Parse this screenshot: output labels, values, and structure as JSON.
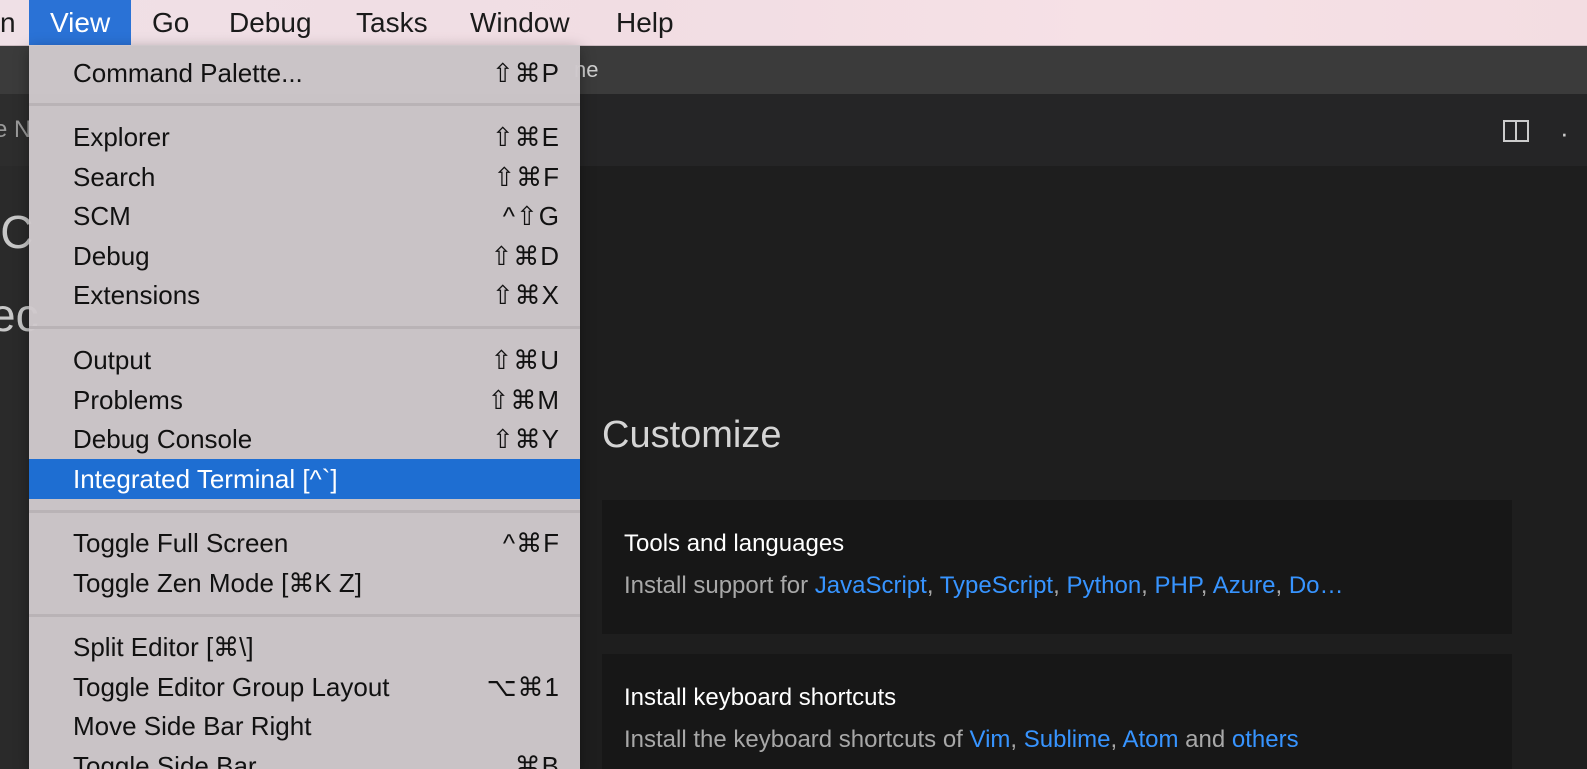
{
  "menubar": {
    "items": [
      {
        "label": "n"
      },
      {
        "label": "View"
      },
      {
        "label": "Go"
      },
      {
        "label": "Debug"
      },
      {
        "label": "Tasks"
      },
      {
        "label": "Window"
      },
      {
        "label": "Help"
      }
    ]
  },
  "editor": {
    "title_fragment": "ne",
    "tab_fragment": "e N",
    "welcome_fragment_1": "lC",
    "welcome_fragment_2": "ec",
    "customize": {
      "heading": "Customize",
      "cards": [
        {
          "title": "Tools and languages",
          "prefix": "Install support for ",
          "links": [
            "JavaScript",
            "TypeScript",
            "Python",
            "PHP",
            "Azure",
            "Do…"
          ]
        },
        {
          "title": "Install keyboard shortcuts",
          "prefix": "Install the keyboard shortcuts of ",
          "links": [
            "Vim",
            "Sublime",
            "Atom"
          ],
          "conjunction": " and ",
          "last_link": "others"
        }
      ]
    }
  },
  "view_menu": {
    "groups": [
      [
        {
          "label": "Command Palette...",
          "shortcut": "⇧⌘P"
        }
      ],
      [
        {
          "label": "Explorer",
          "shortcut": "⇧⌘E"
        },
        {
          "label": "Search",
          "shortcut": "⇧⌘F"
        },
        {
          "label": "SCM",
          "shortcut": "^⇧G"
        },
        {
          "label": "Debug",
          "shortcut": "⇧⌘D"
        },
        {
          "label": "Extensions",
          "shortcut": "⇧⌘X"
        }
      ],
      [
        {
          "label": "Output",
          "shortcut": "⇧⌘U"
        },
        {
          "label": "Problems",
          "shortcut": "⇧⌘M"
        },
        {
          "label": "Debug Console",
          "shortcut": "⇧⌘Y"
        },
        {
          "label": "Integrated Terminal [^`]",
          "shortcut": "",
          "highlighted": true
        }
      ],
      [
        {
          "label": "Toggle Full Screen",
          "shortcut": "^⌘F"
        },
        {
          "label": "Toggle Zen Mode [⌘K Z]",
          "shortcut": ""
        }
      ],
      [
        {
          "label": "Split Editor [⌘\\]",
          "shortcut": ""
        },
        {
          "label": "Toggle Editor Group Layout",
          "shortcut": "⌥⌘1"
        },
        {
          "label": "Move Side Bar Right",
          "shortcut": ""
        },
        {
          "label": "Toggle Side Bar",
          "shortcut": "⌘B"
        }
      ]
    ]
  },
  "colors": {
    "highlight": "#1e6ed2",
    "link": "#3794ff",
    "editor_bg": "#1e1e1e",
    "card_bg": "#171717"
  },
  "icons": {
    "split": "split-editor-icon",
    "more": "more-actions-icon"
  }
}
